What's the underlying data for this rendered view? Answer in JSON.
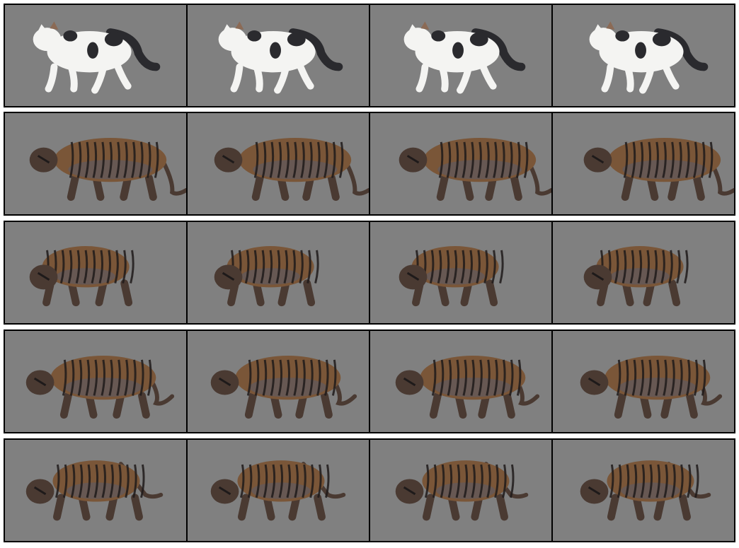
{
  "figure": {
    "rows": [
      {
        "subject": "cat",
        "frames": 4,
        "coat": "white-black-patches"
      },
      {
        "subject": "tiger",
        "frames": 4,
        "coat": "orange-black-stripes"
      },
      {
        "subject": "tiger",
        "frames": 4,
        "coat": "orange-black-stripes"
      },
      {
        "subject": "tiger",
        "frames": 4,
        "coat": "orange-black-stripes"
      },
      {
        "subject": "tiger",
        "frames": 4,
        "coat": "orange-black-stripes"
      }
    ],
    "background_color": "#808080",
    "border_color": "#000000"
  },
  "colors": {
    "cat_fur": "#f4f4f2",
    "cat_patch": "#2a2a2e",
    "tiger_fur": "#7a5638",
    "tiger_dark": "#4a3a32",
    "tiger_stripe": "#1e1a1a",
    "tiger_belly": "#5a5a66"
  }
}
